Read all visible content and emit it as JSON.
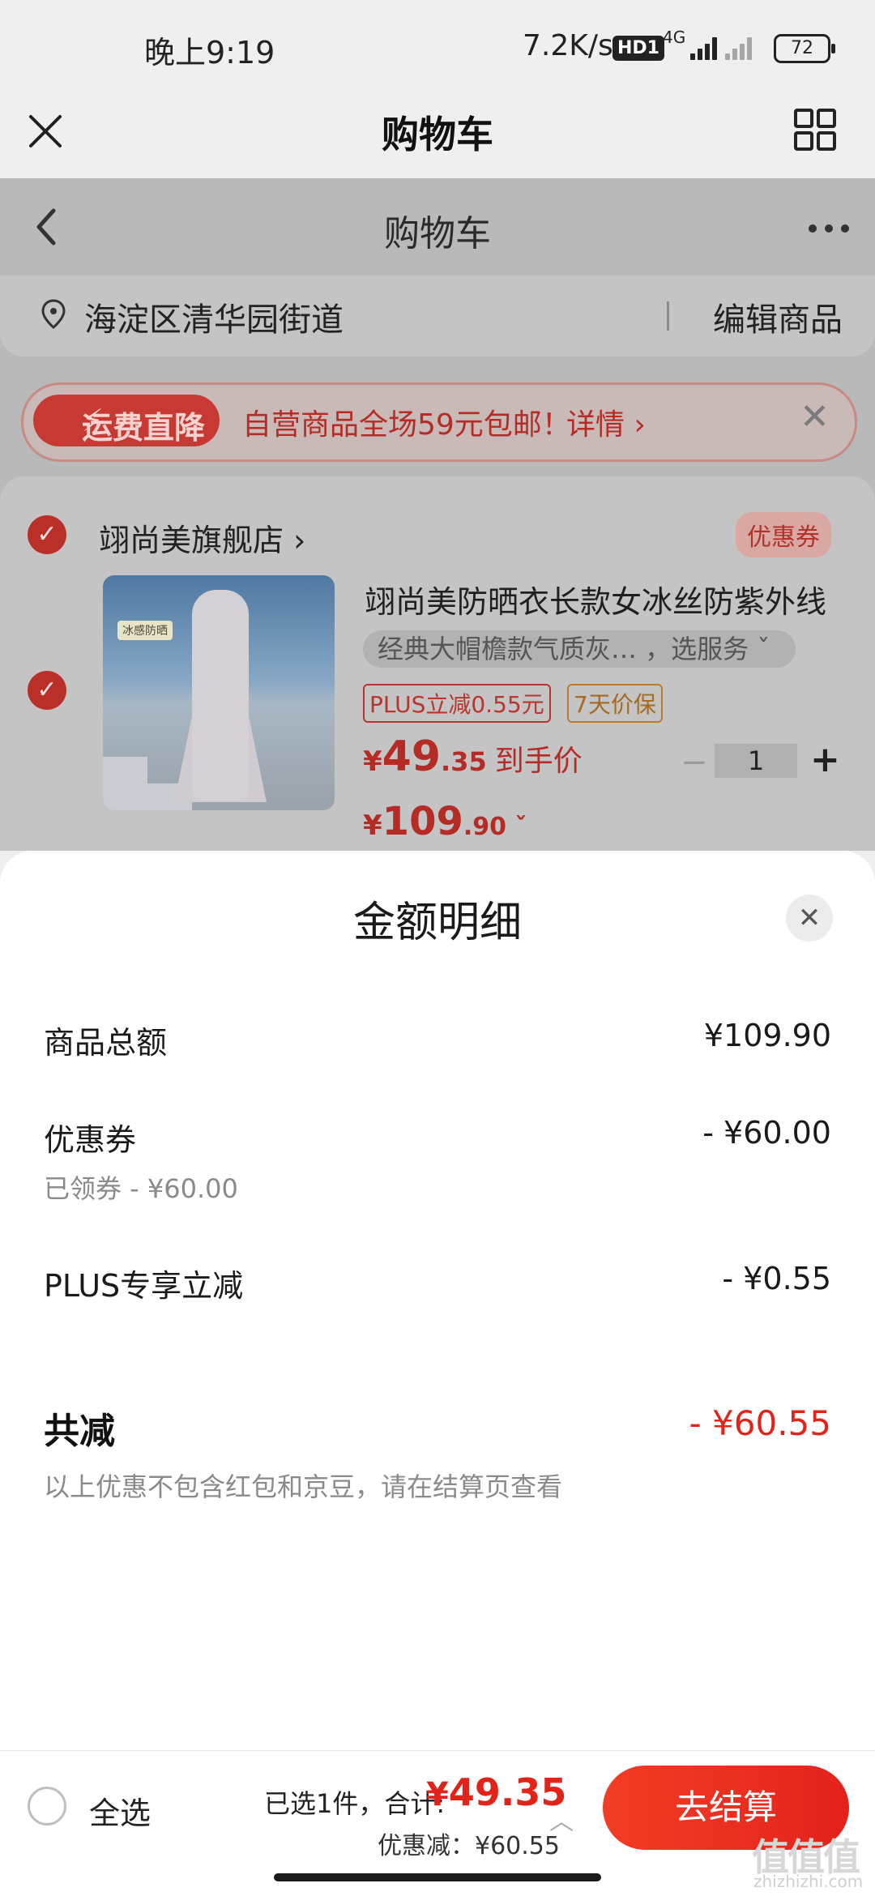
{
  "status_bar": {
    "time": "晚上9:19",
    "speed": "7.2K/s",
    "hd": "HD1",
    "network": "4G",
    "battery": "72"
  },
  "app_header": {
    "title": "购物车",
    "close_icon": "close-icon",
    "menu_icon": "grid-icon"
  },
  "cart_page": {
    "title": "购物车",
    "back_icon": "back-arrow-icon",
    "more_icon": "more-dots-icon",
    "address": "海淀区清华园街道",
    "edit_label": "编辑商品",
    "banner": {
      "badge": "运费直降",
      "promo": "自营商品全场59元包邮！",
      "detail": "详情 ›"
    },
    "store": {
      "name": "翊尚美旗舰店 ›",
      "coupon": "优惠券"
    },
    "product": {
      "image_tag": "冰感防晒",
      "title": "翊尚美防晒衣长款女冰丝防紫外线",
      "spec": "经典大帽檐款气质灰…  ，选服务 ˇ",
      "tag_plus": "PLUS立减0.55元",
      "tag_guarantee": "7天价保",
      "price_final_symbol": "¥",
      "price_final_int": "49",
      "price_final_dec": ".35",
      "price_final_label": "到手价",
      "price_orig_symbol": "¥",
      "price_orig_int": "109",
      "price_orig_dec": ".90 ˇ",
      "quantity": "1",
      "minus": "−",
      "plus": "+"
    }
  },
  "amount_sheet": {
    "title": "金额明细",
    "rows": [
      {
        "label": "商品总额",
        "value": "¥109.90"
      },
      {
        "label": "优惠券",
        "value": "- ¥60.00",
        "sub": "已领券 - ¥60.00"
      },
      {
        "label": "PLUS专享立减",
        "value": "- ¥0.55"
      }
    ],
    "total_label": "共减",
    "total_value": "- ¥60.55",
    "note": "以上优惠不包含红包和京豆，请在结算页查看"
  },
  "bottom_bar": {
    "select_all": "全选",
    "selected_count": "已选1件，合计:",
    "total_symbol": "¥",
    "total_amount": "49.35",
    "discount": "优惠减：¥60.55",
    "checkout": "去结算"
  },
  "watermark": {
    "main": "值值值",
    "sub": "zhizhizhi.com"
  },
  "colors": {
    "accent_red": "#e2231a",
    "checkout_start": "#f23d25",
    "checkout_end": "#e3221c"
  }
}
